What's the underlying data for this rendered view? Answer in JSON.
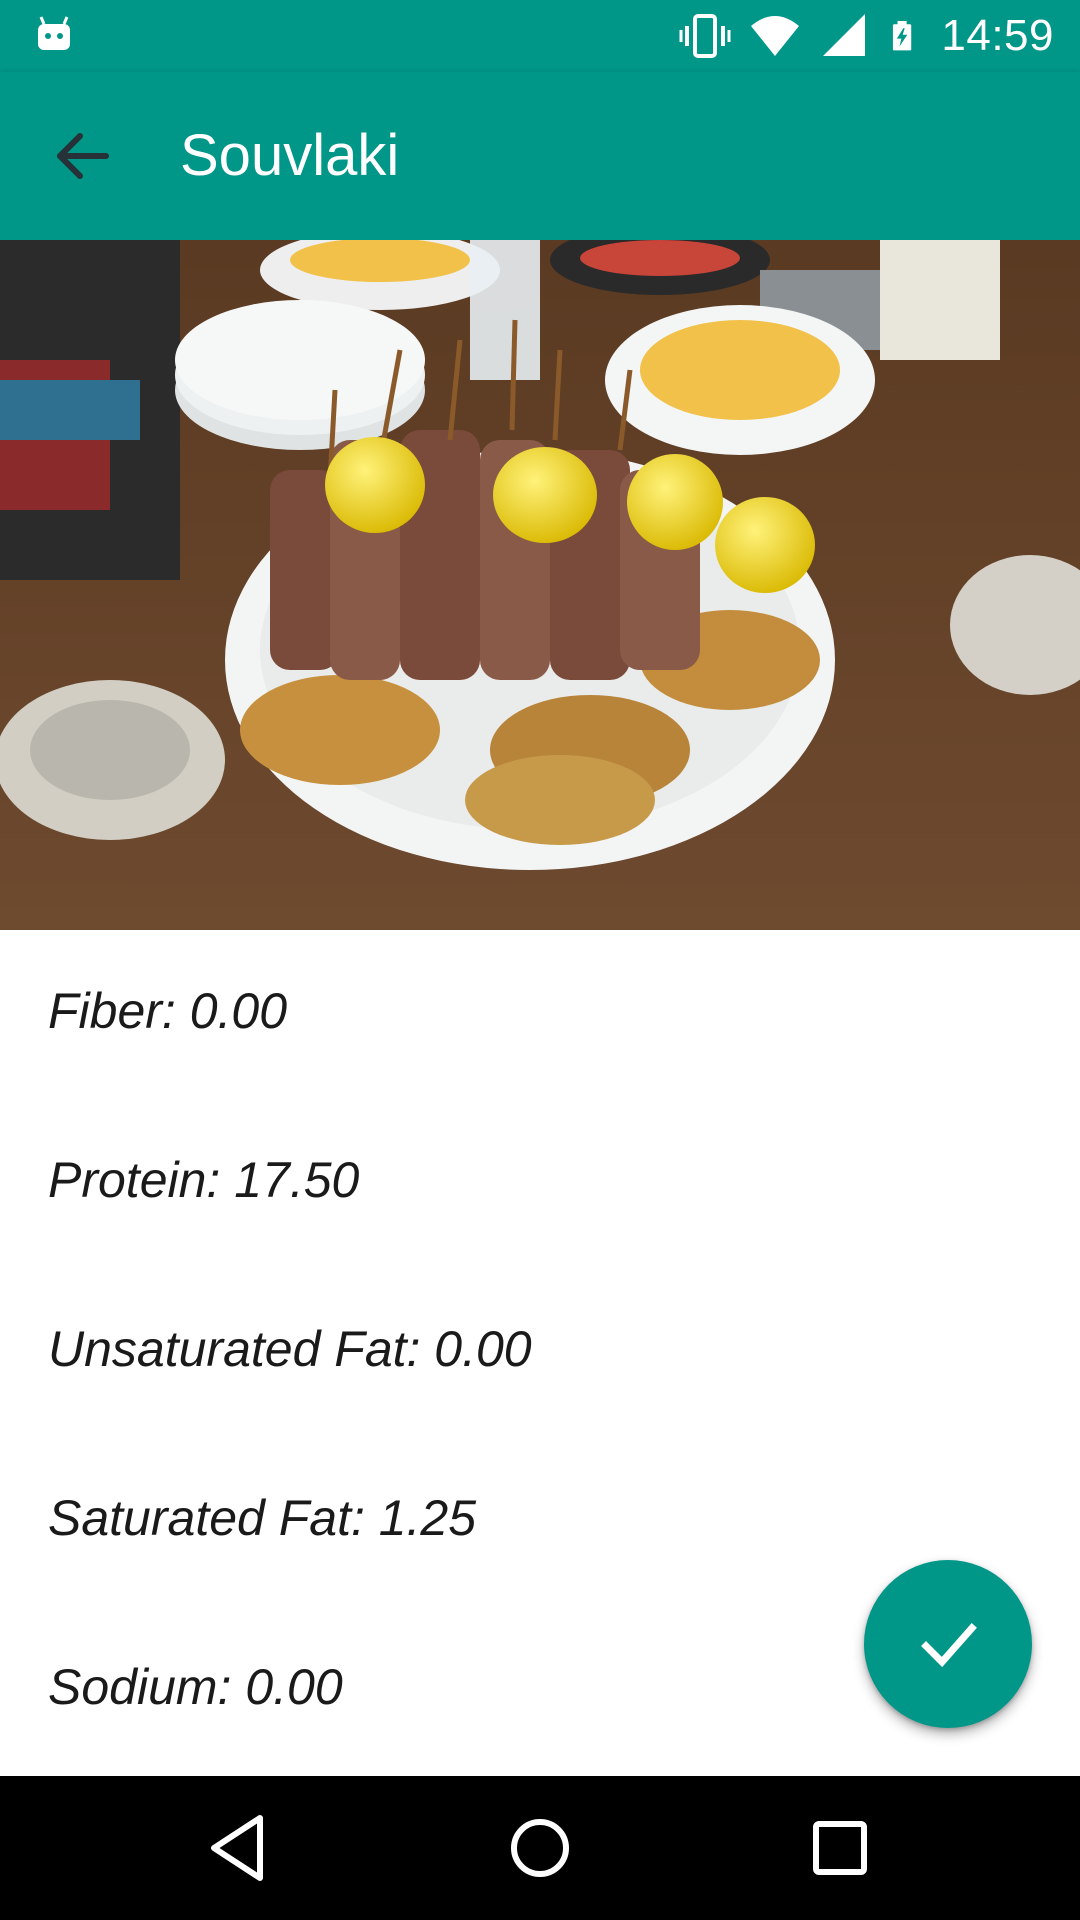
{
  "status_bar": {
    "time": "14:59",
    "icons": [
      "android-icon",
      "vibrate-icon",
      "wifi-icon",
      "signal-icon",
      "battery-charging-icon"
    ]
  },
  "app_bar": {
    "title": "Souvlaki",
    "back_icon": "arrow-back-icon"
  },
  "image": {
    "subject": "souvlaki-plate-photo"
  },
  "nutrients": [
    {
      "label": "Fiber: 0.00"
    },
    {
      "label": "Protein: 17.50"
    },
    {
      "label": "Unsaturated Fat: 0.00"
    },
    {
      "label": "Saturated Fat: 1.25"
    },
    {
      "label": "Sodium: 0.00"
    }
  ],
  "fab": {
    "icon": "check-icon"
  },
  "nav_bar": {
    "icons": [
      "back-triangle-icon",
      "home-circle-icon",
      "recents-square-icon"
    ]
  },
  "colors": {
    "primary": "#009688",
    "nav_bar": "#000000",
    "text": "#1a1a1a"
  }
}
